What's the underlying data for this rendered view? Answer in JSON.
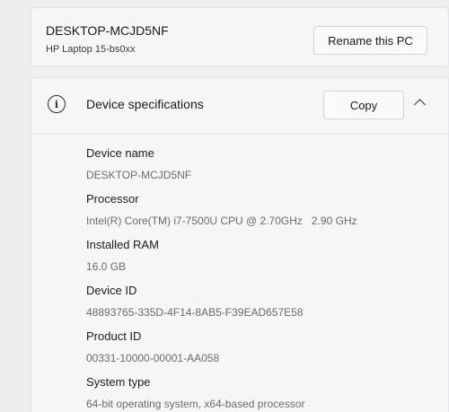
{
  "pc": {
    "name": "DESKTOP-MCJD5NF",
    "model": "HP Laptop 15-bs0xx",
    "rename_label": "Rename this PC"
  },
  "specs": {
    "icon": "info-icon",
    "title": "Device specifications",
    "copy_label": "Copy",
    "collapse_icon": "chevron-up-icon",
    "rows": [
      {
        "label": "Device name",
        "value": "DESKTOP-MCJD5NF"
      },
      {
        "label": "Processor",
        "value": "Intel(R) Core(TM) i7-7500U CPU @ 2.70GHz",
        "value_extra": "2.90 GHz"
      },
      {
        "label": "Installed RAM",
        "value": "16.0 GB"
      },
      {
        "label": "Device ID",
        "value": "48893765-335D-4F14-8AB5-F39EAD657E58"
      },
      {
        "label": "Product ID",
        "value": "00331-10000-00001-AA058"
      },
      {
        "label": "System type",
        "value": "64-bit operating system, x64-based processor"
      }
    ]
  }
}
